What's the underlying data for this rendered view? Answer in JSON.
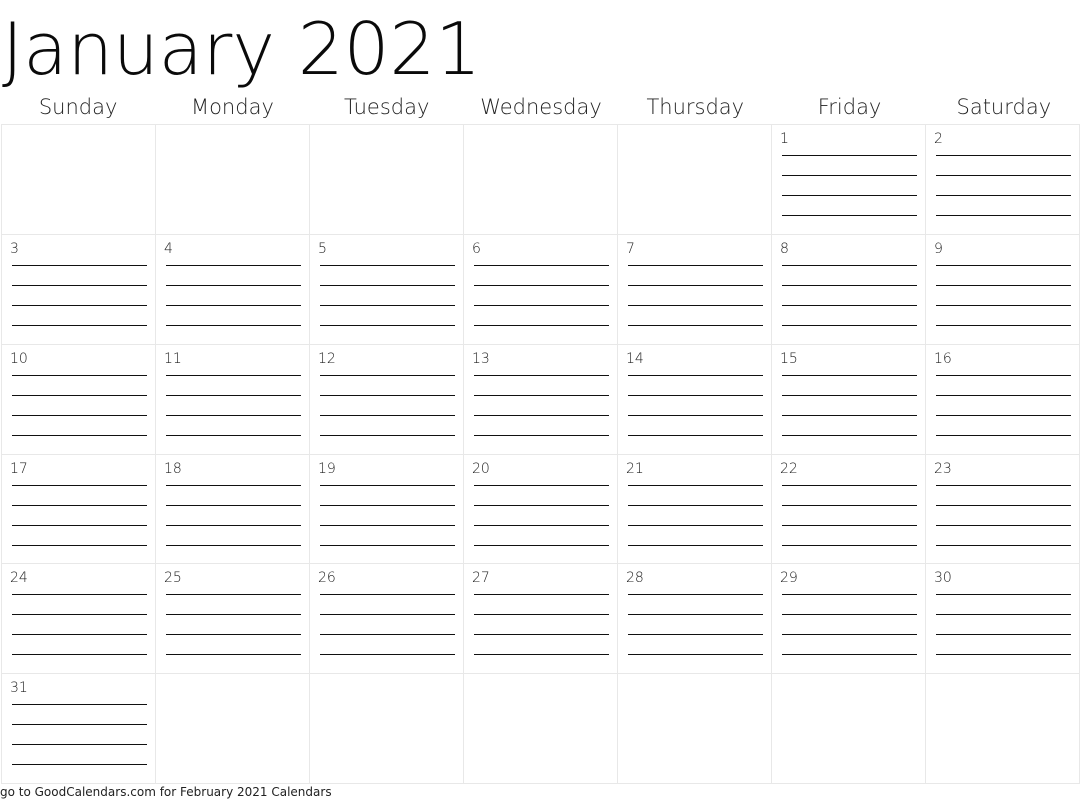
{
  "calendar": {
    "title": "January 2021",
    "weekdays": [
      "Sunday",
      "Monday",
      "Tuesday",
      "Wednesday",
      "Thursday",
      "Friday",
      "Saturday"
    ],
    "weeks": [
      [
        "",
        "",
        "",
        "",
        "",
        "1",
        "2"
      ],
      [
        "3",
        "4",
        "5",
        "6",
        "7",
        "8",
        "9"
      ],
      [
        "10",
        "11",
        "12",
        "13",
        "14",
        "15",
        "16"
      ],
      [
        "17",
        "18",
        "19",
        "20",
        "21",
        "22",
        "23"
      ],
      [
        "24",
        "25",
        "26",
        "27",
        "28",
        "29",
        "30"
      ],
      [
        "31",
        "",
        "",
        "",
        "",
        "",
        ""
      ]
    ],
    "writing_lines_per_day": 4
  },
  "footer": {
    "text": "go to GoodCalendars.com for February 2021 Calendars"
  }
}
